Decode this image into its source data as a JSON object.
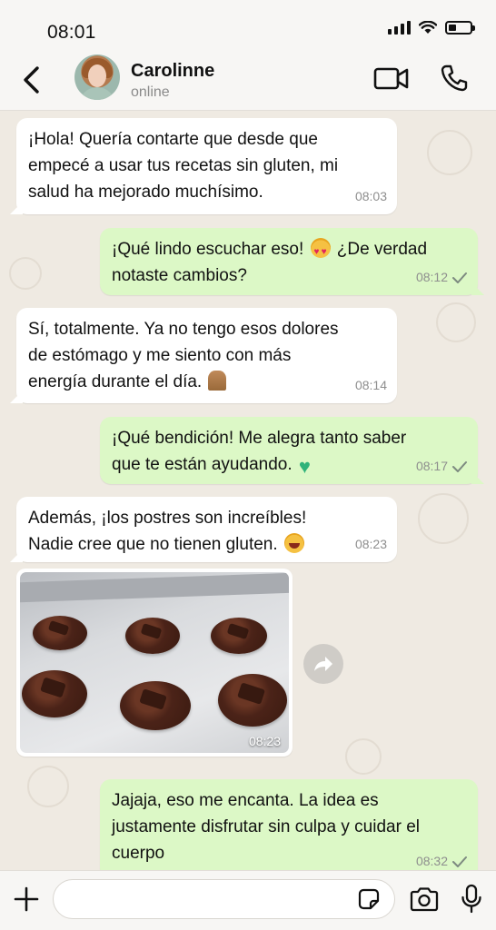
{
  "status_bar": {
    "time": "08:01"
  },
  "header": {
    "contact_name": "Carolinne",
    "contact_status": "online"
  },
  "messages": [
    {
      "direction": "in",
      "text": "¡Hola! Quería contarte que desde que\nempecé a usar tus recetas sin gluten, mi\nsalud ha mejorado muchísimo.",
      "time": "08:03"
    },
    {
      "direction": "out",
      "text_before": "¡Qué lindo escuchar eso! ",
      "emoji": "smiling-face-with-heart-eyes",
      "text_after": " ¿De verdad\nnotaste cambios?",
      "time": "08:12",
      "status": "sent"
    },
    {
      "direction": "in",
      "text": "Sí, totalmente. Ya no tengo esos dolores\nde estómago y me siento con más\nenergía durante el día. ",
      "emoji": "folded-hands",
      "time": "08:14"
    },
    {
      "direction": "out",
      "text": "¡Qué bendición! Me alegra tanto saber\nque te están ayudando. ",
      "emoji": "green-heart",
      "time": "08:17",
      "status": "sent"
    },
    {
      "direction": "in",
      "text": "Además, ¡los postres son increíbles!\nNadie cree que no tienen gluten. ",
      "emoji": "face-with-tears-of-joy",
      "time": "08:23"
    },
    {
      "direction": "in",
      "type": "image",
      "image_description": "Chocolate cookies on a baking tray",
      "time": "08:23"
    },
    {
      "direction": "out",
      "text": "Jajaja, eso me encanta. La idea es\njustamente disfrutar sin culpa y cuidar el\ncuerpo",
      "time": "08:32",
      "status": "sent"
    }
  ],
  "input": {
    "placeholder": ""
  },
  "icons": {
    "back": "chevron-left-icon",
    "video": "video-camera-icon",
    "call": "phone-icon",
    "forward": "forward-arrow-icon",
    "plus": "plus-icon",
    "sticker": "sticker-icon",
    "camera": "camera-icon",
    "mic": "microphone-icon"
  },
  "colors": {
    "chat_bg": "#efeae2",
    "incoming_bubble": "#ffffff",
    "outgoing_bubble": "#dcf8c6",
    "timestamp": "#8e8e8e"
  }
}
